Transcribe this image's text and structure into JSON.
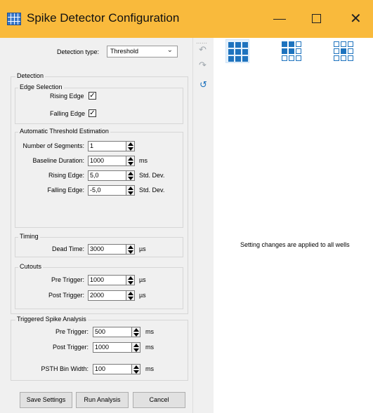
{
  "window": {
    "title": "Spike Detector Configuration",
    "close_glyph": "✕"
  },
  "detection_type": {
    "label": "Detection type:",
    "value": "Threshold"
  },
  "detection": {
    "title": "Detection",
    "edge_selection": {
      "title": "Edge Selection",
      "rising": {
        "label": "Rising Edge",
        "checked": "✓"
      },
      "falling": {
        "label": "Falling Edge",
        "checked": "✓"
      }
    },
    "auto_threshold": {
      "title": "Automatic Threshold Estimation",
      "segments": {
        "label": "Number of Segments:",
        "value": "1"
      },
      "baseline": {
        "label": "Baseline Duration:",
        "value": "1000",
        "unit": "ms"
      },
      "rising": {
        "label": "Rising Edge:",
        "value": "5,0",
        "unit": "Std. Dev."
      },
      "falling": {
        "label": "Falling Edge:",
        "value": "-5,0",
        "unit": "Std. Dev."
      }
    },
    "timing": {
      "title": "Timing",
      "dead_time": {
        "label": "Dead Time:",
        "value": "3000",
        "unit": "µs"
      }
    },
    "cutouts": {
      "title": "Cutouts",
      "pre": {
        "label": "Pre Trigger:",
        "value": "1000",
        "unit": "µs"
      },
      "post": {
        "label": "Post Trigger:",
        "value": "2000",
        "unit": "µs"
      }
    }
  },
  "triggered": {
    "title": "Triggered Spike Analysis",
    "pre": {
      "label": "Pre Trigger:",
      "value": "500",
      "unit": "ms"
    },
    "post": {
      "label": "Post Trigger:",
      "value": "1000",
      "unit": "ms"
    },
    "bin": {
      "label": "PSTH Bin Width:",
      "value": "100",
      "unit": "ms"
    }
  },
  "buttons": {
    "save": "Save Settings",
    "run": "Run Analysis",
    "cancel": "Cancel"
  },
  "toolbar": {
    "grip": "⋯⋯",
    "undo": "↶",
    "redo": "↷",
    "reset": "↺"
  },
  "right_message": "Setting changes are applied to all wells",
  "colors": {
    "titlebar": "#f9ba3c",
    "grid_full": "#1e73be"
  }
}
